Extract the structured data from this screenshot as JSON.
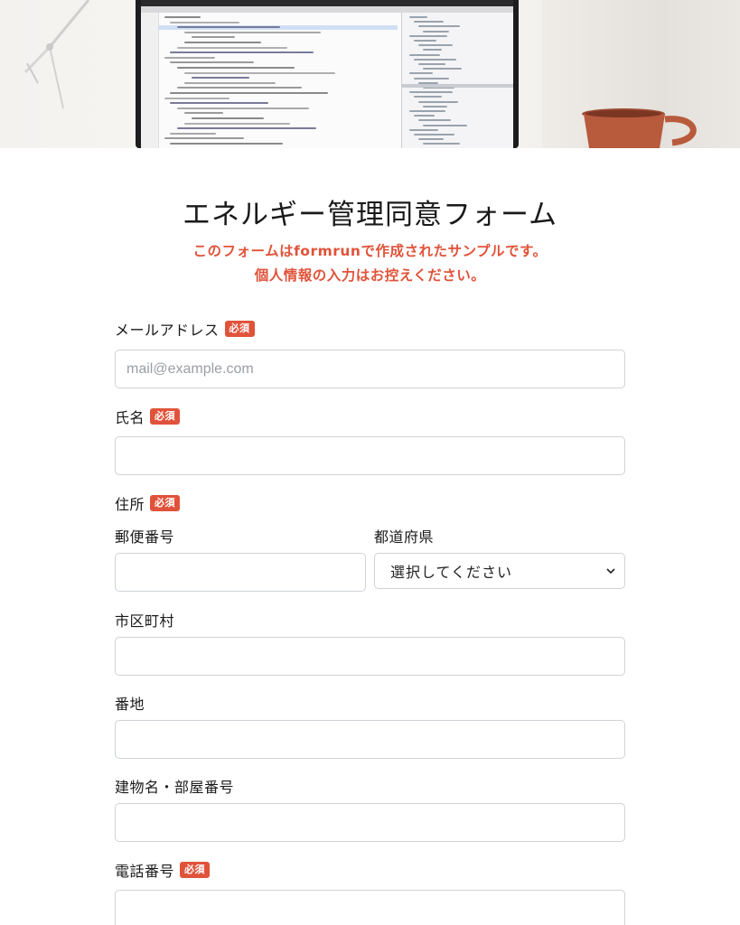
{
  "form": {
    "title": "エネルギー管理同意フォーム",
    "notice_line1": "このフォームはformrunで作成されたサンプルです。",
    "notice_line2": "個人情報の入力はお控えください。"
  },
  "required_badge": "必須",
  "fields": {
    "email": {
      "label": "メールアドレス",
      "placeholder": "mail@example.com",
      "value": ""
    },
    "name": {
      "label": "氏名",
      "value": ""
    },
    "address": {
      "label": "住所",
      "postal_code": {
        "label": "郵便番号",
        "value": ""
      },
      "prefecture": {
        "label": "都道府県",
        "selected": "選択してください"
      },
      "city": {
        "label": "市区町村",
        "value": ""
      },
      "street": {
        "label": "番地",
        "value": ""
      },
      "building": {
        "label": "建物名・部屋番号",
        "value": ""
      }
    },
    "phone": {
      "label": "電話番号",
      "value": ""
    }
  },
  "colors": {
    "accent": "#e0533a",
    "input_border": "#cfd3d7"
  }
}
